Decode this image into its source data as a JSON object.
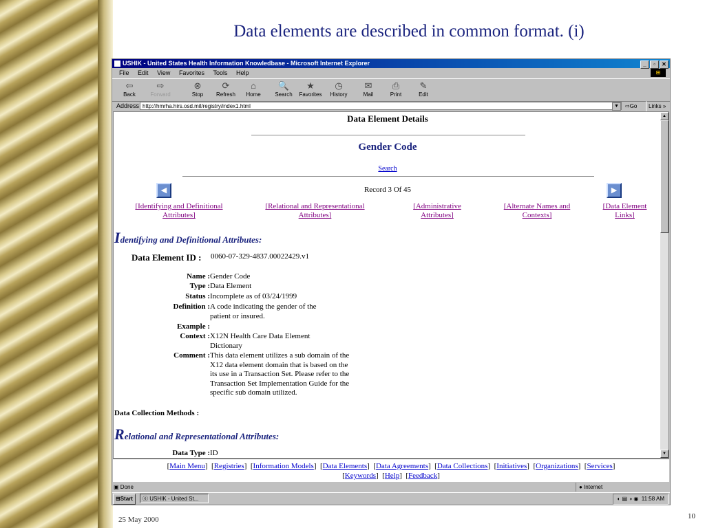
{
  "slide": {
    "title": "Data elements are described in common format. (i)",
    "date": "25 May 2000",
    "page_number": "10"
  },
  "window": {
    "title": "USHIK - United States Health Information Knowledbase - Microsoft Internet Explorer",
    "menu": [
      "File",
      "Edit",
      "View",
      "Favorites",
      "Tools",
      "Help"
    ],
    "toolbar": [
      {
        "label": "Back",
        "icon": "back-arrow-icon",
        "glyph": "⇦"
      },
      {
        "label": "Forward",
        "icon": "forward-arrow-icon",
        "glyph": "⇨"
      },
      {
        "label": "Stop",
        "icon": "stop-icon",
        "glyph": "⊗"
      },
      {
        "label": "Refresh",
        "icon": "refresh-icon",
        "glyph": "⟳"
      },
      {
        "label": "Home",
        "icon": "home-icon",
        "glyph": "⌂"
      },
      {
        "label": "Search",
        "icon": "search-icon",
        "glyph": "🔍"
      },
      {
        "label": "Favorites",
        "icon": "favorites-icon",
        "glyph": "★"
      },
      {
        "label": "History",
        "icon": "history-icon",
        "glyph": "◷"
      },
      {
        "label": "Mail",
        "icon": "mail-icon",
        "glyph": "✉"
      },
      {
        "label": "Print",
        "icon": "print-icon",
        "glyph": "⎙"
      },
      {
        "label": "Edit",
        "icon": "edit-icon",
        "glyph": "✎"
      }
    ],
    "address_label": "Address",
    "address_url": "http://hmrha.hirs.osd.mil/registry/index1.html",
    "go_label": "Go",
    "links_label": "Links"
  },
  "page": {
    "heading": "Data Element Details",
    "element_title": "Gender Code",
    "search_link": "Search",
    "record": "Record 3 Of 45",
    "section_links": [
      {
        "line1": "[Identifying and Definitional",
        "line2": "Attributes]"
      },
      {
        "line1": "[Relational and Representational",
        "line2": "Attributes]"
      },
      {
        "line1": "[Administrative",
        "line2": "Attributes]"
      },
      {
        "line1": "[Alternate Names and",
        "line2": "Contexts]"
      },
      {
        "line1": "[Data Element",
        "line2": "Links]"
      }
    ],
    "section1": {
      "initial": "I",
      "rest": "dentifying and Definitional Attributes:"
    },
    "data_element_id_label": "Data Element ID :",
    "data_element_id": "0060-07-329-4837.00022429.v1",
    "fields": {
      "name_label": "Name :",
      "name": "Gender Code",
      "type_label": "Type :",
      "type": "Data Element",
      "status_label": "Status :",
      "status": "Incomplete as of 03/24/1999",
      "definition_label": "Definition :",
      "definition": "A code indicating the gender of the patient or insured.",
      "example_label": "Example :",
      "context_label": "Context :",
      "context": "X12N Health Care Data Element Dictionary",
      "comment_label": "Comment :",
      "comment": "This data element utilizes a sub domain of the X12 data element domain that is based on the its use in a Transaction Set. Please refer to the Transaction Set Implementation Guide for the specific sub domain utilized."
    },
    "data_collection_label": "Data Collection Methods :",
    "section2": {
      "initial": "R",
      "rest": "elational and Representational Attributes:"
    },
    "data_type_label": "Data Type :",
    "data_type": "ID"
  },
  "bottom_nav": {
    "row1": [
      "Main Menu",
      "Registries",
      "Information Models",
      "Data Elements",
      "Data Agreements",
      "Data Collections",
      "Initiatives",
      "Organizations",
      "Services"
    ],
    "row2": [
      "Keywords",
      "Help",
      "Feedback"
    ]
  },
  "status": {
    "text": "Done",
    "zone": "Internet"
  },
  "taskbar": {
    "start_label": "Start",
    "task_item": "USHIK - United St...",
    "clock": "11:58 AM"
  }
}
